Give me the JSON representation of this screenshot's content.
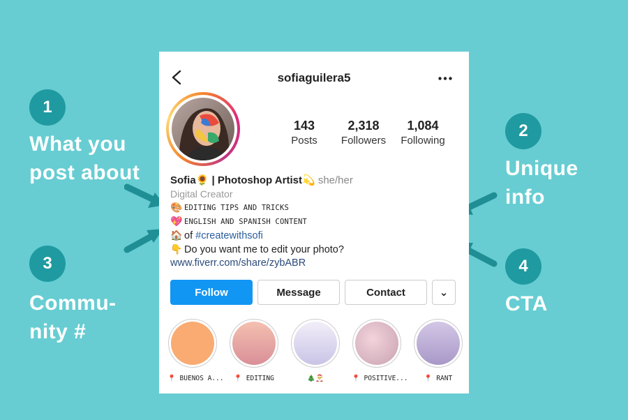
{
  "annotations": [
    {
      "number": "1",
      "text": "What you post about"
    },
    {
      "number": "2",
      "text": "Unique info"
    },
    {
      "number": "3",
      "text": "Commu- nity #"
    },
    {
      "number": "4",
      "text": "CTA"
    }
  ],
  "profile": {
    "username": "sofiaguilera5",
    "stats": [
      {
        "value": "143",
        "label": "Posts"
      },
      {
        "value": "2,318",
        "label": "Followers"
      },
      {
        "value": "1,084",
        "label": "Following"
      }
    ],
    "bio": {
      "name": "Sofia🌻 | Photoshop Artist💫",
      "pronouns": "she/her",
      "category": "Digital Creator",
      "lines": [
        {
          "emoji": "🎨",
          "text": "EDITING TIPS AND TRICKS"
        },
        {
          "emoji": "💖",
          "text": "ENGLISH AND SPANISH CONTENT"
        },
        {
          "emoji": "🏠",
          "prefix": "of ",
          "hashtag": "#createwithsofi"
        },
        {
          "emoji": "👇",
          "text": "Do you want me to edit your photo?"
        }
      ],
      "link": "www.fiverr.com/share/zybABR"
    },
    "buttons": {
      "follow": "Follow",
      "message": "Message",
      "contact": "Contact",
      "more": "⌄"
    },
    "highlights": [
      {
        "label": "📍 BUENOS A...",
        "color": "#f9ab72"
      },
      {
        "label": "📍 EDITING",
        "color": "#e59a9a"
      },
      {
        "label": "🎄🎅",
        "color": "#dcd8f0"
      },
      {
        "label": "📍 POSITIVE...",
        "color": "#d6a9b4"
      },
      {
        "label": "📍 RANT",
        "color": "#b7a6cf"
      }
    ]
  },
  "colors": {
    "background": "#67cdd2",
    "badge": "#1f9aa0",
    "arrow": "#1f8f95",
    "follow_button": "#1296f3"
  }
}
